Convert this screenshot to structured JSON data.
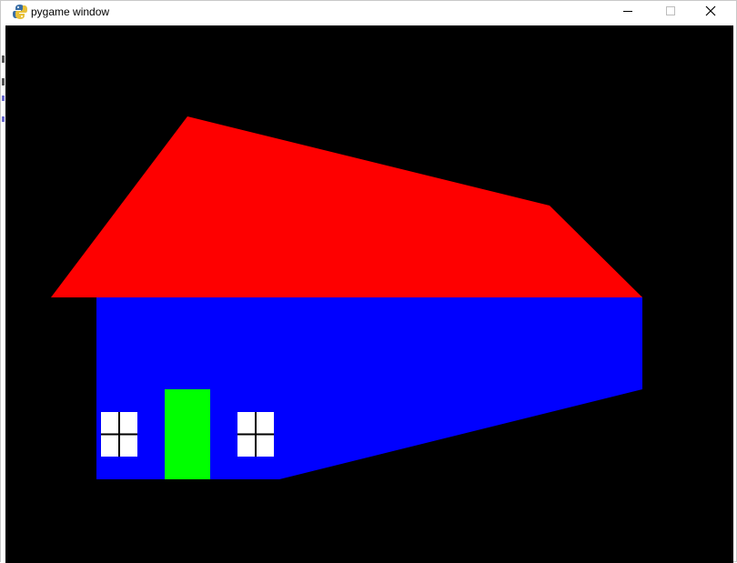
{
  "window": {
    "title": "pygame window",
    "app_icon": "pygame-snake-icon",
    "controls": {
      "minimize_icon": "minimize-icon",
      "maximize_icon": "maximize-icon",
      "close_icon": "close-icon"
    }
  },
  "scene": {
    "background_color": "#000000",
    "roof_color": "#fe0000",
    "wall_color": "#0000ff",
    "door_color": "#00ff00",
    "window_color": "#ffffff",
    "window_frame_color": "#000000"
  }
}
